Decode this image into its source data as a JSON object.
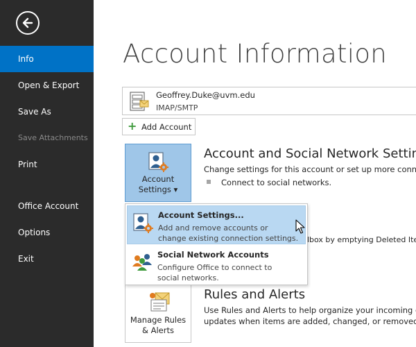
{
  "sidebar": {
    "back_icon": "back-arrow-icon",
    "items": [
      {
        "label": "Info",
        "active": true
      },
      {
        "label": "Open & Export"
      },
      {
        "label": "Save As"
      },
      {
        "label": "Save Attachments",
        "disabled": true
      },
      {
        "label": "Print"
      },
      {
        "label": "Office Account"
      },
      {
        "label": "Options"
      },
      {
        "label": "Exit"
      }
    ]
  },
  "page": {
    "title": "Account Information"
  },
  "account": {
    "email": "Geoffrey.Duke@uvm.edu",
    "type": "IMAP/SMTP",
    "icon": "mailbox-icon"
  },
  "add_account": {
    "label": "Add Account",
    "icon": "plus-icon"
  },
  "account_settings": {
    "button_label_line1": "Account",
    "button_label_line2": "Settings ▾",
    "section_title": "Account and Social Network Settings",
    "section_desc": "Change settings for this account or set up more connectio",
    "bullet": "Connect to social networks."
  },
  "menu": {
    "items": [
      {
        "title": "Account Settings...",
        "desc_line1": "Add and remove accounts or",
        "desc_line2": "change existing connection settings.",
        "icon": "account-settings-icon"
      },
      {
        "title": "Social Network Accounts",
        "desc_line1": "Configure Office to connect to",
        "desc_line2": "social networks.",
        "icon": "social-network-icon"
      }
    ]
  },
  "cleanup_partial": "lbox by emptying Deleted Ite",
  "rules": {
    "button_label_line1": "Manage Rules",
    "button_label_line2": "& Alerts",
    "section_title": "Rules and Alerts",
    "desc_line1": "Use Rules and Alerts to help organize your incoming e-ma",
    "desc_line2": "updates when items are added, changed, or removed."
  },
  "colors": {
    "sidebar_bg": "#2b2b2b",
    "active_accent": "#0072c6",
    "tile_highlight": "#9fc6e8",
    "menu_highlight": "#b9d8f2"
  }
}
